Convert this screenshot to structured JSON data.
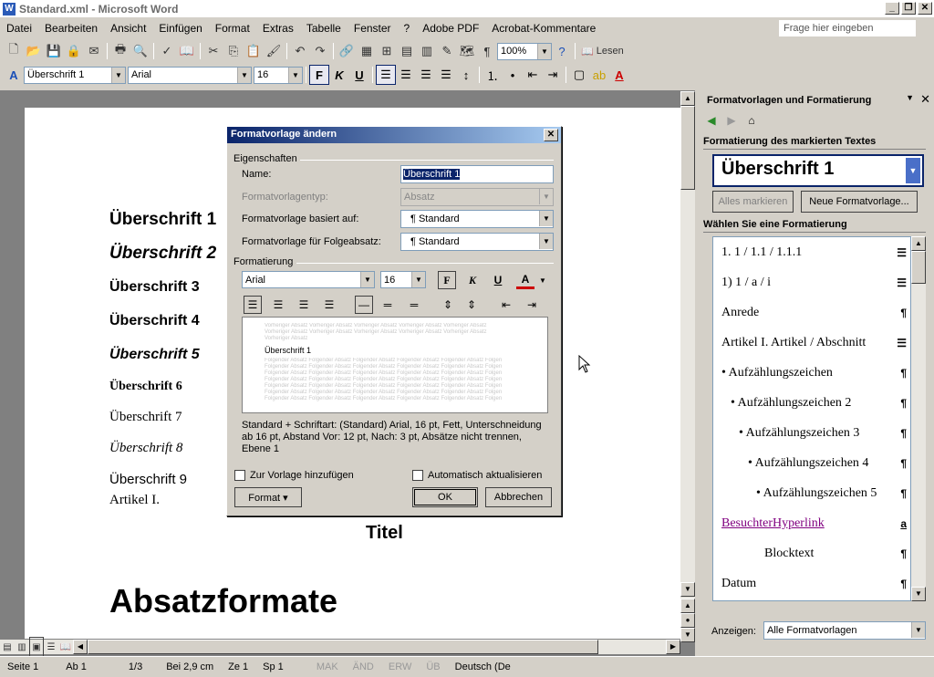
{
  "window": {
    "title": "Standard.xml - Microsoft Word",
    "app_icon": "W"
  },
  "menu": [
    "Datei",
    "Bearbeiten",
    "Ansicht",
    "Einfügen",
    "Format",
    "Extras",
    "Tabelle",
    "Fenster",
    "?",
    "Adobe PDF",
    "Acrobat-Kommentare"
  ],
  "ask": {
    "placeholder": "Frage hier eingeben"
  },
  "toolbar1": {
    "zoom": "100%",
    "read": "Lesen"
  },
  "toolbar2": {
    "style": "Überschrift 1",
    "font": "Arial",
    "size": "16"
  },
  "document": {
    "headings": [
      "Überschrift 1",
      "Überschrift 2",
      "Überschrift 3",
      "Überschrift 4",
      "Überschrift 5",
      "Überschrift 6",
      "Überschrift 7",
      "Überschrift 8",
      "Überschrift 9",
      "Artikel I."
    ],
    "titel": "Titel",
    "big": "Absatzformate"
  },
  "status": {
    "seite": "Seite 1",
    "ab": "Ab 1",
    "pages": "1/3",
    "bei": "Bei 2,9 cm",
    "ze": "Ze 1",
    "sp": "Sp 1",
    "mak": "MAK",
    "aend": "ÄND",
    "erw": "ERW",
    "ueb": "ÜB",
    "lang": "Deutsch (De"
  },
  "pane": {
    "title": "Formatvorlagen und Formatierung",
    "selected_heading": "Formatierung des markierten Textes",
    "current_style": "Überschrift 1",
    "select_all": "Alles markieren",
    "new_style": "Neue Formatvorlage...",
    "choose_heading": "Wählen Sie eine Formatierung",
    "styles": [
      {
        "label": "1.  1 / 1.1 / 1.1.1",
        "mark": "☰"
      },
      {
        "label": "1)  1 / a / i",
        "mark": "☰"
      },
      {
        "label": "Anrede",
        "mark": "¶"
      },
      {
        "label": "Artikel I.  Artikel / Abschnitt",
        "mark": "☰"
      },
      {
        "label": "• Aufzählungszeichen",
        "mark": "¶"
      },
      {
        "label": "• Aufzählungszeichen 2",
        "mark": "¶"
      },
      {
        "label": "• Aufzählungszeichen 3",
        "mark": "¶"
      },
      {
        "label": "• Aufzählungszeichen 4",
        "mark": "¶"
      },
      {
        "label": "• Aufzählungszeichen 5",
        "mark": "¶"
      },
      {
        "label": "BesuchterHyperlink",
        "mark": "a"
      },
      {
        "label": "Blocktext",
        "mark": "¶"
      },
      {
        "label": "Datum",
        "mark": "¶"
      }
    ],
    "show_label": "Anzeigen:",
    "show_value": "Alle Formatvorlagen"
  },
  "dialog": {
    "title": "Formatvorlage ändern",
    "props_group": "Eigenschaften",
    "name_label": "Name:",
    "name_value": "Überschrift 1",
    "type_label": "Formatvorlagentyp:",
    "type_value": "Absatz",
    "based_label": "Formatvorlage basiert auf:",
    "based_value": "¶ Standard",
    "next_label": "Formatvorlage für Folgeabsatz:",
    "next_value": "¶ Standard",
    "format_group": "Formatierung",
    "font": "Arial",
    "size": "16",
    "preview_text": "Überschrift 1",
    "description": "Standard + Schriftart: (Standard) Arial, 16 pt, Fett, Unterschneidung ab 16 pt, Abstand Vor:  12 pt, Nach:  3 pt, Absätze nicht trennen, Ebene 1",
    "add_template": "Zur Vorlage hinzufügen",
    "auto_update": "Automatisch aktualisieren",
    "format_btn": "Format ▾",
    "ok": "OK",
    "cancel": "Abbrechen"
  }
}
